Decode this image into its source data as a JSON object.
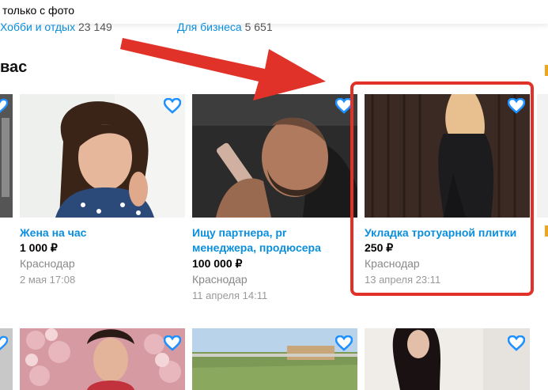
{
  "filter": {
    "only_photo": "только с фото"
  },
  "categories": [
    {
      "label": "Хобби и отдых",
      "count": "23 149"
    },
    {
      "label": "Для бизнеса",
      "count": "5 651"
    }
  ],
  "section": {
    "title_fragment": "вас"
  },
  "listings": [
    {
      "title_line1": "Жена на час",
      "title_line2": "",
      "price": "1 000 ₽",
      "city": "Краснодар",
      "date": "2 мая 17:08"
    },
    {
      "title_line1": "Ищу партнера, pr",
      "title_line2": "менеджера, продюсера",
      "price": "100 000 ₽",
      "city": "Краснодар",
      "date": "11 апреля 14:11"
    },
    {
      "title_line1": "Укладка тротуарной плитки",
      "title_line2": "",
      "price": "250 ₽",
      "city": "Краснодар",
      "date": "13 апреля 23:11"
    }
  ],
  "colors": {
    "link": "#0a8ede",
    "highlight": "#e03228",
    "heart": "#1e90ff"
  },
  "icons": {
    "favorite": "heart-outline-icon",
    "annotation": "red-arrow-icon"
  }
}
